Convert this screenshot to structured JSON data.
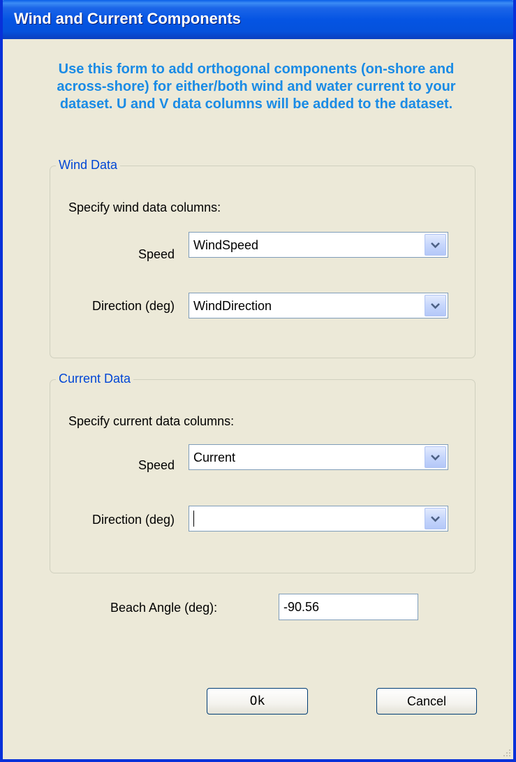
{
  "window": {
    "title": "Wind and Current Components"
  },
  "instructions": "Use this form to add orthogonal components (on-shore and across-shore) for either/both wind and water current to your dataset.  U and V data columns will be added to the dataset.",
  "wind_group": {
    "legend": "Wind Data",
    "subtitle": "Specify wind data columns:",
    "speed_label": "Speed",
    "speed_value": "WindSpeed",
    "direction_label": "Direction (deg)",
    "direction_value": "WindDirection"
  },
  "current_group": {
    "legend": "Current Data",
    "subtitle": "Specify current data columns:",
    "speed_label": "Speed",
    "speed_value": "Current",
    "direction_label": "Direction (deg)",
    "direction_value": ""
  },
  "beach_angle": {
    "label": "Beach Angle (deg):",
    "value": "-90.56"
  },
  "buttons": {
    "ok": "Ok",
    "cancel": "Cancel"
  },
  "colors": {
    "titlebar": "#0554e3",
    "instruction_text": "#1a8be5",
    "group_legend": "#0046d5",
    "dialog_background": "#ece9d8"
  },
  "icons": {
    "dropdown": "chevron-down-icon",
    "resize": "resize-grip-icon"
  }
}
